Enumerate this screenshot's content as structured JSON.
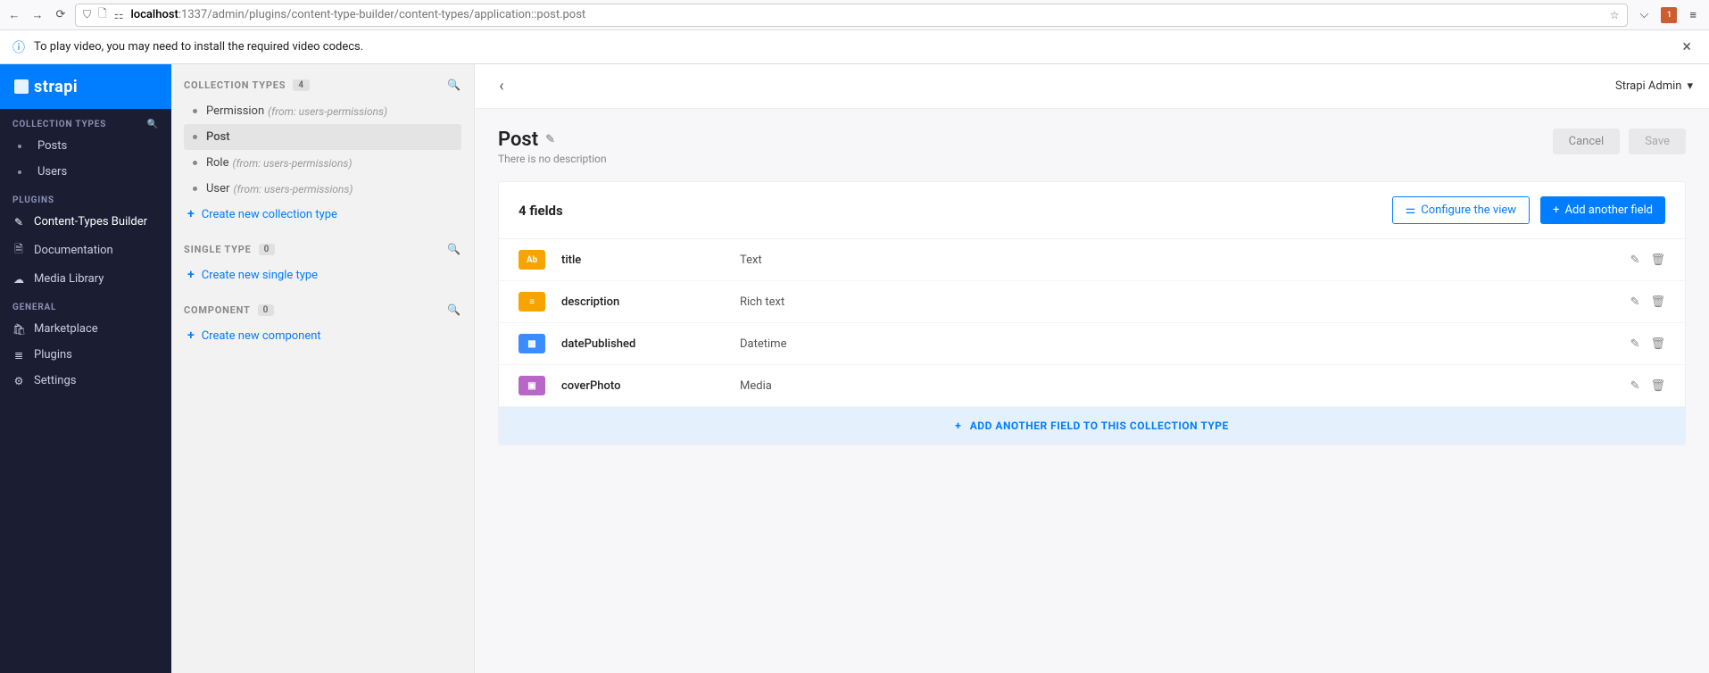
{
  "browser": {
    "url_host": "localhost",
    "url_path": ":1337/admin/plugins/content-type-builder/content-types/application::post.post",
    "ext_badge": "1"
  },
  "notification": {
    "text": "To play video, you may need to install the required video codecs."
  },
  "logo": "strapi",
  "sidebar_main": {
    "collection_title": "COLLECTION TYPES",
    "plugins_title": "PLUGINS",
    "general_title": "GENERAL",
    "collection_items": [
      {
        "label": "Posts"
      },
      {
        "label": "Users"
      }
    ],
    "plugins_items": [
      {
        "label": "Content-Types Builder",
        "icon": "✎",
        "active": true
      },
      {
        "label": "Documentation",
        "icon": "🗎"
      },
      {
        "label": "Media Library",
        "icon": "☁"
      }
    ],
    "general_items": [
      {
        "label": "Marketplace",
        "icon": "🛍"
      },
      {
        "label": "Plugins",
        "icon": "≣"
      },
      {
        "label": "Settings",
        "icon": "⚙"
      }
    ]
  },
  "sidebar_sec": {
    "collection": {
      "title": "COLLECTION TYPES",
      "count": "4",
      "items": [
        {
          "label": "Permission",
          "src": "(from: users-permissions)"
        },
        {
          "label": "Post",
          "src": "",
          "active": true
        },
        {
          "label": "Role",
          "src": "(from: users-permissions)"
        },
        {
          "label": "User",
          "src": "(from: users-permissions)"
        }
      ],
      "create": "Create new collection type"
    },
    "single": {
      "title": "SINGLE TYPE",
      "count": "0",
      "create": "Create new single type"
    },
    "component": {
      "title": "COMPONENT",
      "count": "0",
      "create": "Create new component"
    }
  },
  "header": {
    "user": "Strapi Admin"
  },
  "content": {
    "title": "Post",
    "description": "There is no description",
    "cancel": "Cancel",
    "save": "Save",
    "fields_count": "4 fields",
    "configure": "Configure the view",
    "add_field": "Add another field",
    "add_row": "ADD ANOTHER FIELD TO THIS COLLECTION TYPE",
    "fields": [
      {
        "name": "title",
        "type": "Text",
        "icon_class": "fi-text",
        "icon_label": "Ab"
      },
      {
        "name": "description",
        "type": "Rich text",
        "icon_class": "fi-rich",
        "icon_label": "≡"
      },
      {
        "name": "datePublished",
        "type": "Datetime",
        "icon_class": "fi-date",
        "icon_label": "▦"
      },
      {
        "name": "coverPhoto",
        "type": "Media",
        "icon_class": "fi-media",
        "icon_label": "▣"
      }
    ]
  }
}
